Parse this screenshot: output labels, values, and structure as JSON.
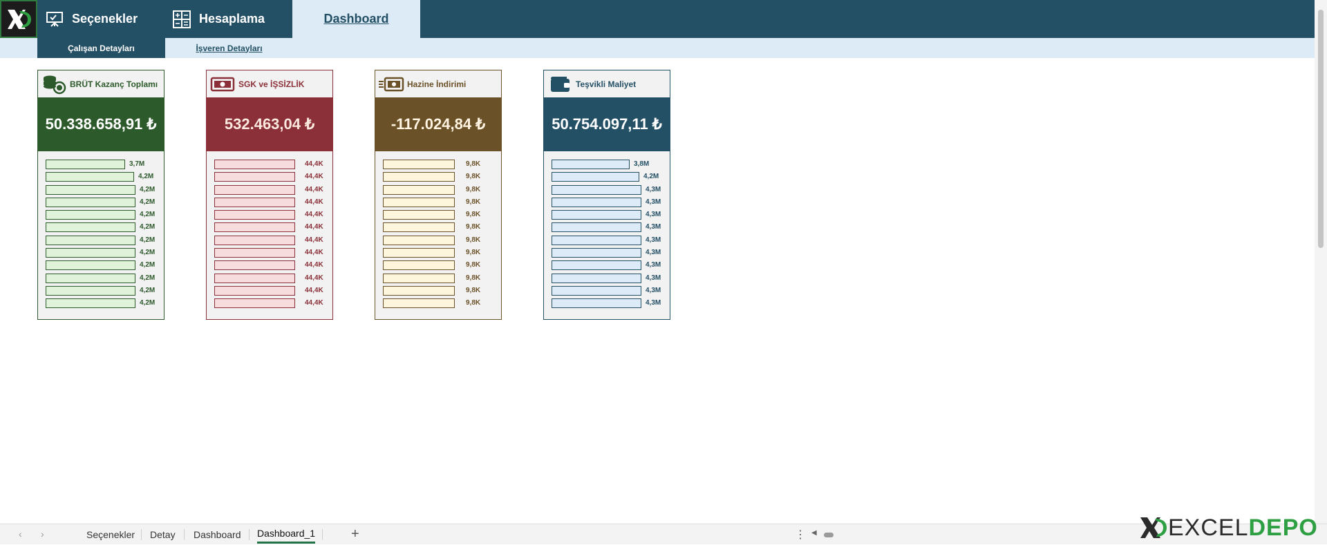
{
  "nav": {
    "tabs": [
      {
        "label": "Seçenekler",
        "icon": "presentation-board-icon"
      },
      {
        "label": "Hesaplama",
        "icon": "calculator-icon"
      },
      {
        "label": "Dashboard",
        "icon": ""
      }
    ],
    "subtabs": [
      "Çalışan Detayları",
      "İşveren Detayları"
    ]
  },
  "cards": [
    {
      "title": "BRÜT Kazanç Toplamı",
      "icon": "coin-stack-icon",
      "total": "50.338.658,91 ₺",
      "colors": {
        "primary": "#2d5a2b",
        "bar_fill": "#e1f2da",
        "bar_border": "#2d5a2b",
        "label": "#2d5a2b"
      },
      "bars": [
        {
          "label": "3,7M",
          "value": 3.7
        },
        {
          "label": "4,2M",
          "value": 4.15
        },
        {
          "label": "4,2M",
          "value": 4.2
        },
        {
          "label": "4,2M",
          "value": 4.2
        },
        {
          "label": "4,2M",
          "value": 4.2
        },
        {
          "label": "4,2M",
          "value": 4.2
        },
        {
          "label": "4,2M",
          "value": 4.2
        },
        {
          "label": "4,2M",
          "value": 4.2
        },
        {
          "label": "4,2M",
          "value": 4.2
        },
        {
          "label": "4,2M",
          "value": 4.2
        },
        {
          "label": "4,2M",
          "value": 4.2
        },
        {
          "label": "4,2M",
          "value": 4.2
        }
      ]
    },
    {
      "title": "SGK ve İŞSİZLİK",
      "icon": "banknote-icon",
      "total": "532.463,04 ₺",
      "colors": {
        "primary": "#8b3038",
        "bar_fill": "#f6dcdc",
        "bar_border": "#8b3038",
        "label": "#8b3038"
      },
      "bars": [
        {
          "label": "44,4K",
          "value": 44.4
        },
        {
          "label": "44,4K",
          "value": 44.4
        },
        {
          "label": "44,4K",
          "value": 44.4
        },
        {
          "label": "44,4K",
          "value": 44.4
        },
        {
          "label": "44,4K",
          "value": 44.4
        },
        {
          "label": "44,4K",
          "value": 44.4
        },
        {
          "label": "44,4K",
          "value": 44.4
        },
        {
          "label": "44,4K",
          "value": 44.4
        },
        {
          "label": "44,4K",
          "value": 44.4
        },
        {
          "label": "44,4K",
          "value": 44.4
        },
        {
          "label": "44,4K",
          "value": 44.4
        },
        {
          "label": "44,4K",
          "value": 44.4
        }
      ]
    },
    {
      "title": "Hazine İndirimi",
      "icon": "fast-money-icon",
      "total": "-117.024,84 ₺",
      "colors": {
        "primary": "#6b5128",
        "bar_fill": "#fdf5dc",
        "bar_border": "#6b5128",
        "label": "#6b5128"
      },
      "bars": [
        {
          "label": "9,8K",
          "value": 9.8
        },
        {
          "label": "9,8K",
          "value": 9.8
        },
        {
          "label": "9,8K",
          "value": 9.8
        },
        {
          "label": "9,8K",
          "value": 9.8
        },
        {
          "label": "9,8K",
          "value": 9.8
        },
        {
          "label": "9,8K",
          "value": 9.8
        },
        {
          "label": "9,8K",
          "value": 9.8
        },
        {
          "label": "9,8K",
          "value": 9.8
        },
        {
          "label": "9,8K",
          "value": 9.8
        },
        {
          "label": "9,8K",
          "value": 9.8
        },
        {
          "label": "9,8K",
          "value": 9.8
        },
        {
          "label": "9,8K",
          "value": 9.8
        }
      ]
    },
    {
      "title": "Teşvikli Maliyet",
      "icon": "wallet-icon",
      "total": "50.754.097,11 ₺",
      "colors": {
        "primary": "#245066",
        "bar_fill": "#dcebf7",
        "bar_border": "#245066",
        "label": "#245066"
      },
      "bars": [
        {
          "label": "3,8M",
          "value": 3.75
        },
        {
          "label": "4,2M",
          "value": 4.2
        },
        {
          "label": "4,3M",
          "value": 4.3
        },
        {
          "label": "4,3M",
          "value": 4.3
        },
        {
          "label": "4,3M",
          "value": 4.3
        },
        {
          "label": "4,3M",
          "value": 4.3
        },
        {
          "label": "4,3M",
          "value": 4.3
        },
        {
          "label": "4,3M",
          "value": 4.3
        },
        {
          "label": "4,3M",
          "value": 4.3
        },
        {
          "label": "4,3M",
          "value": 4.3
        },
        {
          "label": "4,3M",
          "value": 4.3
        },
        {
          "label": "4,3M",
          "value": 4.3
        }
      ]
    }
  ],
  "sheets": {
    "tabs": [
      "Seçenekler",
      "Detay",
      "Dashboard",
      "Dashboard_1"
    ],
    "active": "Dashboard_1",
    "add_label": "+",
    "more_label": "⋮"
  },
  "brand": {
    "part1": "EXCEL",
    "part2": "DEPO",
    "accent": "#2ea043"
  }
}
